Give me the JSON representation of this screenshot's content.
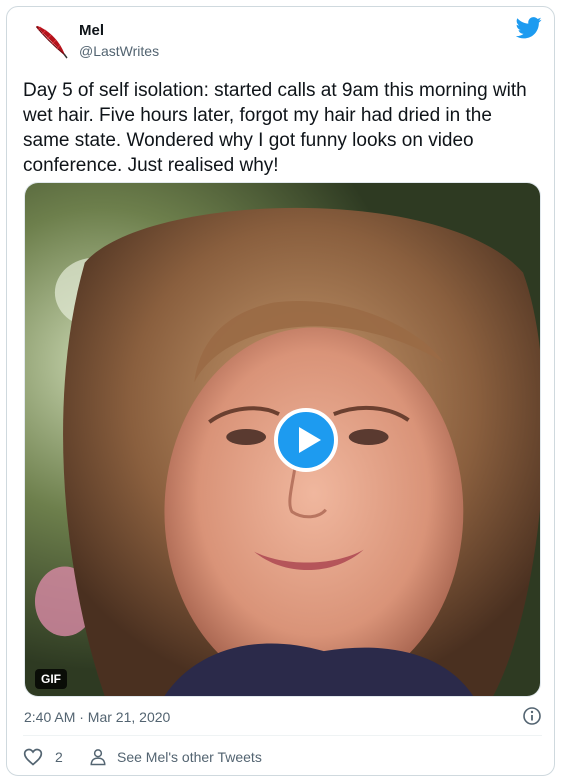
{
  "user": {
    "name": "Mel",
    "handle": "@LastWrites",
    "avatar_icon": "quill-feather-icon"
  },
  "tweet": {
    "text": "Day 5 of self isolation: started calls at 9am this morning with wet hair. Five hours later, forgot my hair had dried in the same state. Wondered why I got funny looks on video conference. Just realised why!",
    "media_badge": "GIF",
    "timestamp": "2:40 AM · Mar 21, 2020"
  },
  "actions": {
    "like_count": "2",
    "see_others_label": "See Mel's other Tweets"
  },
  "colors": {
    "twitter_blue": "#1d9bf0",
    "secondary_text": "#536471",
    "border": "#cfd9de"
  }
}
